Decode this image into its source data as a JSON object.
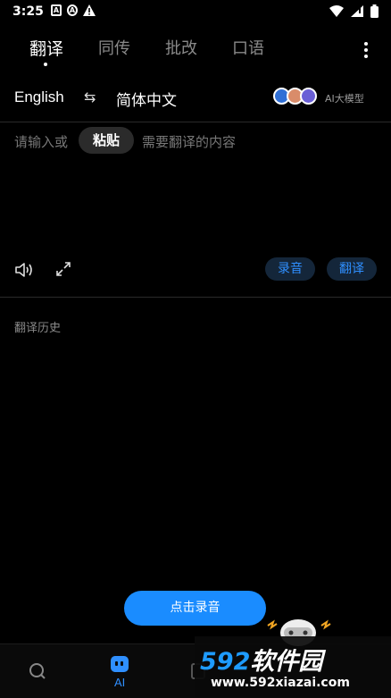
{
  "status_bar": {
    "time": "3:25",
    "icon_a": "A",
    "icon_b": "A"
  },
  "tabs": [
    {
      "label": "翻译",
      "active": true
    },
    {
      "label": "同传",
      "active": false
    },
    {
      "label": "批改",
      "active": false
    },
    {
      "label": "口语",
      "active": false
    }
  ],
  "languages": {
    "source": "English",
    "target": "简体中文",
    "swap_icon": "⇆"
  },
  "ai_model_label": "AI大模型",
  "input": {
    "placeholder_before": "请输入或",
    "paste_label": "粘贴",
    "placeholder_after": "需要翻译的内容"
  },
  "actions": {
    "record_label": "录音",
    "translate_label": "翻译"
  },
  "history_title": "翻译历史",
  "record_button_label": "点击录音",
  "bottom_nav": {
    "ai_label": "AI"
  },
  "watermark": {
    "main_num": "592",
    "main_text": "软件园",
    "url": "www.592xiazai.com"
  },
  "colors": {
    "accent": "#2f8fff",
    "background": "#000000"
  }
}
